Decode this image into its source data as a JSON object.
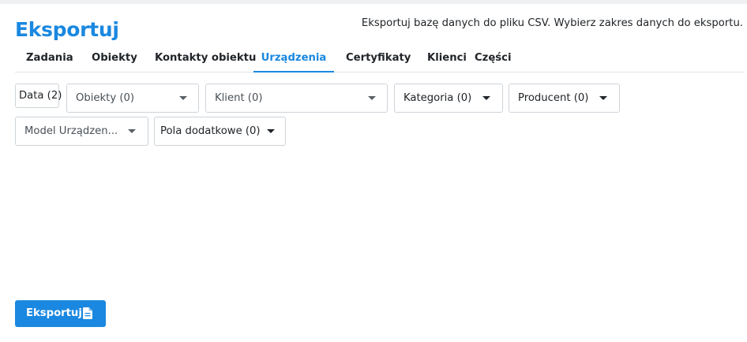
{
  "header": {
    "title": "Eksportuj",
    "description": "Eksportuj bazę danych do pliku CSV. Wybierz zakres danych do eksportu."
  },
  "tabs": [
    {
      "label": "Zadania",
      "active": false
    },
    {
      "label": "Obiekty",
      "active": false
    },
    {
      "label": "Kontakty obiektu",
      "active": false
    },
    {
      "label": "Urządzenia",
      "active": true
    },
    {
      "label": "Certyfikaty",
      "active": false
    },
    {
      "label": "Klienci",
      "active": false
    },
    {
      "label": "Części",
      "active": false
    }
  ],
  "filters": {
    "date_label": "Data (2)",
    "obiekty_label": "Obiekty (0)",
    "klient_label": "Klient (0)",
    "kategoria_label": "Kategoria (0)",
    "producent_label": "Producent (0)",
    "model_label": "Model Urządzen...",
    "pola_label": "Pola dodatkowe (0)"
  },
  "export_button": {
    "label": "Eksportuj",
    "icon": "file-document-icon"
  },
  "colors": {
    "accent": "#1a88e0",
    "border": "#ced4da",
    "text": "#212529"
  }
}
